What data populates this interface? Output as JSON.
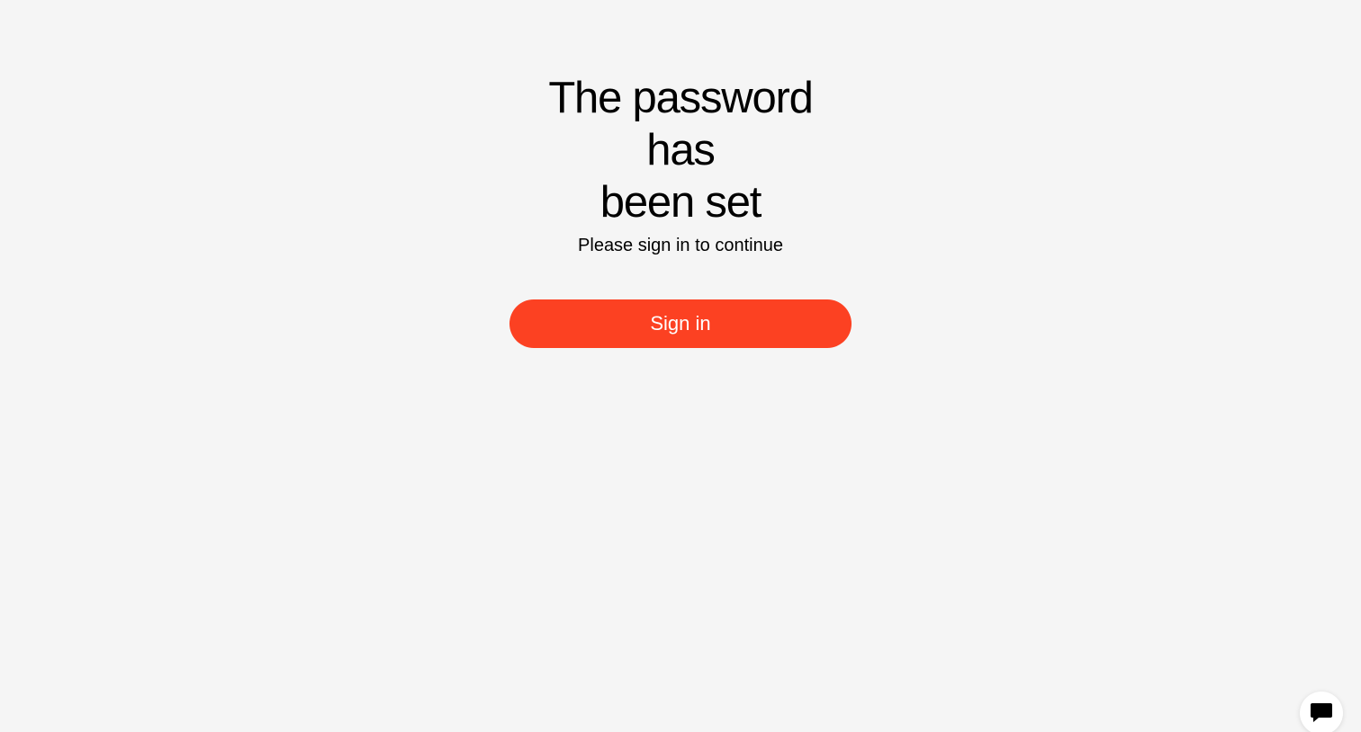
{
  "main": {
    "title_line1": "The password has",
    "title_line2": "been set",
    "subtitle": "Please sign in to continue",
    "signin_label": "Sign in"
  },
  "chat": {
    "icon": "chat-bubble-icon"
  },
  "colors": {
    "background": "#f5f5f5",
    "accent": "#fc4122",
    "text": "#000000"
  }
}
